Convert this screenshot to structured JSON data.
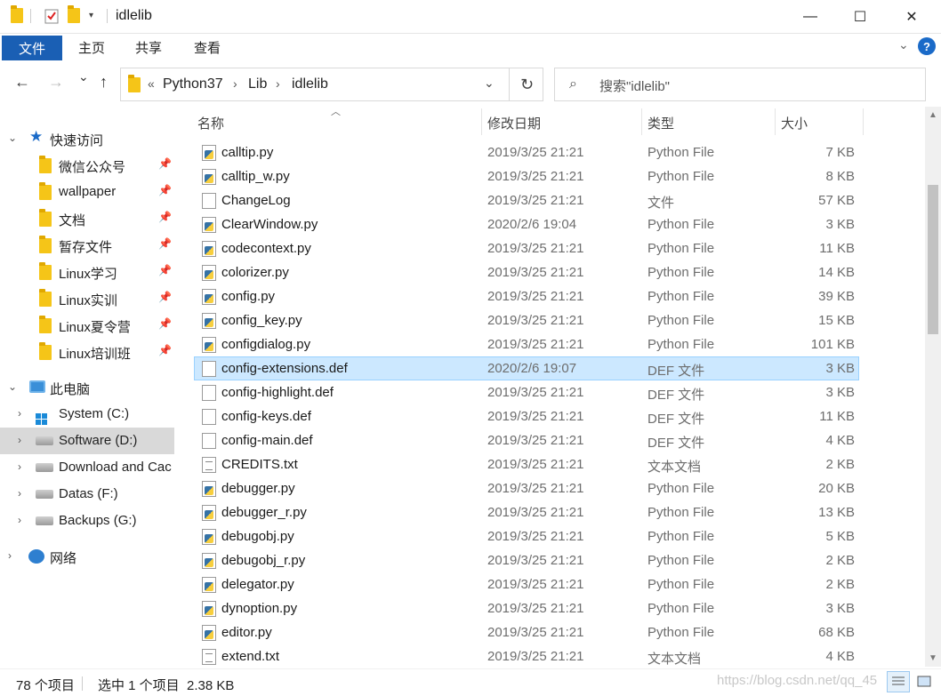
{
  "window": {
    "title": "idlelib",
    "minimize": "—",
    "maximize": "☐",
    "close": "✕"
  },
  "ribbon": {
    "tabs": [
      "文件",
      "主页",
      "共享",
      "查看"
    ],
    "expand_icon": "chevron-down-icon",
    "help_icon": "?"
  },
  "nav": {
    "back": "←",
    "forward": "→",
    "recent": "⌄",
    "up": "↑",
    "breadcrumb_overflow": "«",
    "breadcrumb": [
      "Python37",
      "Lib",
      "idlelib"
    ],
    "search_placeholder": "搜索\"idlelib\""
  },
  "sidebar": {
    "quick_access": "快速访问",
    "pinned": [
      "微信公众号",
      "wallpaper",
      "文档",
      "暂存文件",
      "Linux学习",
      "Linux实训",
      "Linux夏令营",
      "Linux培训班"
    ],
    "this_pc": "此电脑",
    "drives": [
      "System (C:)",
      "Software (D:)",
      "Download and Cac",
      "Datas (F:)",
      "Backups (G:)"
    ],
    "selected_drive": "Software (D:)",
    "network": "网络"
  },
  "columns": {
    "name": "名称",
    "date": "修改日期",
    "type": "类型",
    "size": "大小"
  },
  "files": [
    {
      "name": "calltip.py",
      "date": "2019/3/25 21:21",
      "type": "Python File",
      "size": "7 KB",
      "icon": "py"
    },
    {
      "name": "calltip_w.py",
      "date": "2019/3/25 21:21",
      "type": "Python File",
      "size": "8 KB",
      "icon": "py"
    },
    {
      "name": "ChangeLog",
      "date": "2019/3/25 21:21",
      "type": "文件",
      "size": "57 KB",
      "icon": "blank"
    },
    {
      "name": "ClearWindow.py",
      "date": "2020/2/6 19:04",
      "type": "Python File",
      "size": "3 KB",
      "icon": "py"
    },
    {
      "name": "codecontext.py",
      "date": "2019/3/25 21:21",
      "type": "Python File",
      "size": "11 KB",
      "icon": "py"
    },
    {
      "name": "colorizer.py",
      "date": "2019/3/25 21:21",
      "type": "Python File",
      "size": "14 KB",
      "icon": "py"
    },
    {
      "name": "config.py",
      "date": "2019/3/25 21:21",
      "type": "Python File",
      "size": "39 KB",
      "icon": "py"
    },
    {
      "name": "config_key.py",
      "date": "2019/3/25 21:21",
      "type": "Python File",
      "size": "15 KB",
      "icon": "py"
    },
    {
      "name": "configdialog.py",
      "date": "2019/3/25 21:21",
      "type": "Python File",
      "size": "101 KB",
      "icon": "py"
    },
    {
      "name": "config-extensions.def",
      "date": "2020/2/6 19:07",
      "type": "DEF 文件",
      "size": "3 KB",
      "icon": "blank",
      "selected": true
    },
    {
      "name": "config-highlight.def",
      "date": "2019/3/25 21:21",
      "type": "DEF 文件",
      "size": "3 KB",
      "icon": "blank"
    },
    {
      "name": "config-keys.def",
      "date": "2019/3/25 21:21",
      "type": "DEF 文件",
      "size": "11 KB",
      "icon": "blank"
    },
    {
      "name": "config-main.def",
      "date": "2019/3/25 21:21",
      "type": "DEF 文件",
      "size": "4 KB",
      "icon": "blank"
    },
    {
      "name": "CREDITS.txt",
      "date": "2019/3/25 21:21",
      "type": "文本文档",
      "size": "2 KB",
      "icon": "txt"
    },
    {
      "name": "debugger.py",
      "date": "2019/3/25 21:21",
      "type": "Python File",
      "size": "20 KB",
      "icon": "py"
    },
    {
      "name": "debugger_r.py",
      "date": "2019/3/25 21:21",
      "type": "Python File",
      "size": "13 KB",
      "icon": "py"
    },
    {
      "name": "debugobj.py",
      "date": "2019/3/25 21:21",
      "type": "Python File",
      "size": "5 KB",
      "icon": "py"
    },
    {
      "name": "debugobj_r.py",
      "date": "2019/3/25 21:21",
      "type": "Python File",
      "size": "2 KB",
      "icon": "py"
    },
    {
      "name": "delegator.py",
      "date": "2019/3/25 21:21",
      "type": "Python File",
      "size": "2 KB",
      "icon": "py"
    },
    {
      "name": "dynoption.py",
      "date": "2019/3/25 21:21",
      "type": "Python File",
      "size": "3 KB",
      "icon": "py"
    },
    {
      "name": "editor.py",
      "date": "2019/3/25 21:21",
      "type": "Python File",
      "size": "68 KB",
      "icon": "py"
    },
    {
      "name": "extend.txt",
      "date": "2019/3/25 21:21",
      "type": "文本文档",
      "size": "4 KB",
      "icon": "txt"
    }
  ],
  "status": {
    "count": "78 个项目",
    "selection": "选中 1 个项目  2.38 KB",
    "watermark": "https://blog.csdn.net/qq_45"
  }
}
